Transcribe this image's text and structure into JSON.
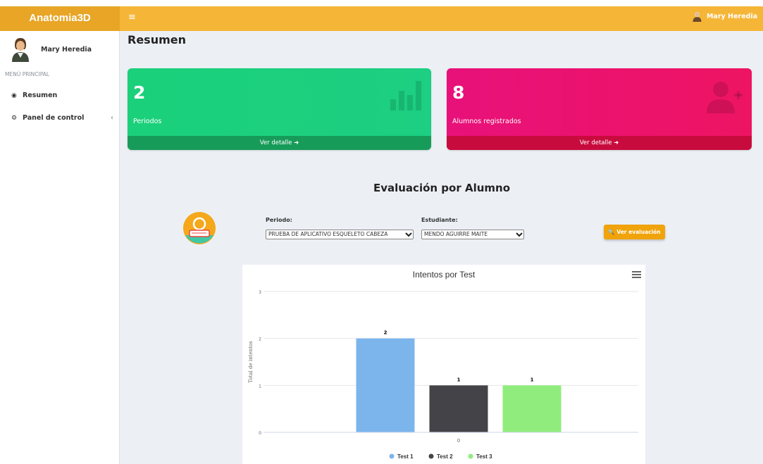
{
  "app": {
    "logo": "Anatomia3D",
    "menu_icon": "≡"
  },
  "navbar": {
    "user_name": "Mary Heredia",
    "user_icon": "user-avatar-icon"
  },
  "sidebar": {
    "user_name": "Mary Heredia",
    "section_header": "MENÚ PRINCIPAL",
    "items": [
      {
        "label": "Resumen",
        "icon": "dashboard-icon"
      },
      {
        "label": "Panel de control",
        "icon": "gear-icon",
        "chevron": "‹"
      }
    ]
  },
  "page": {
    "title": "Resumen"
  },
  "stats": [
    {
      "value": "2",
      "label": "Periodos",
      "link": "Ver detalle",
      "color": "#1bd07a",
      "icon": "bar-chart-icon"
    },
    {
      "value": "8",
      "label": "Alumnos registrados",
      "link": "Ver detalle",
      "color": "#ec1270",
      "icon": "user-plus-icon"
    }
  ],
  "evaluation": {
    "title": "Evaluación por Alumno",
    "periodo_label": "Periodo:",
    "periodo_value": "PRUEBA DE APLICATIVO ESQUELETO CABEZA",
    "estudiante_label": "Estudiante:",
    "estudiante_value": "MENDO AGUIRRE MAITE",
    "button_label": "Ver evaluación"
  },
  "chart_data": {
    "type": "bar",
    "title": "Intentos por Test",
    "ylabel": "Total de intentos",
    "xlabel": "",
    "categories": [
      "0"
    ],
    "series": [
      {
        "name": "Test 1",
        "values": [
          2
        ],
        "color": "#7cb5ec"
      },
      {
        "name": "Test 2",
        "values": [
          1
        ],
        "color": "#434348"
      },
      {
        "name": "Test 3",
        "values": [
          1
        ],
        "color": "#90ed7d"
      }
    ],
    "yticks": [
      0,
      1,
      2,
      3
    ],
    "ylim": [
      0,
      3
    ],
    "grid": true,
    "legend": "bottom-center",
    "data_labels": true
  }
}
